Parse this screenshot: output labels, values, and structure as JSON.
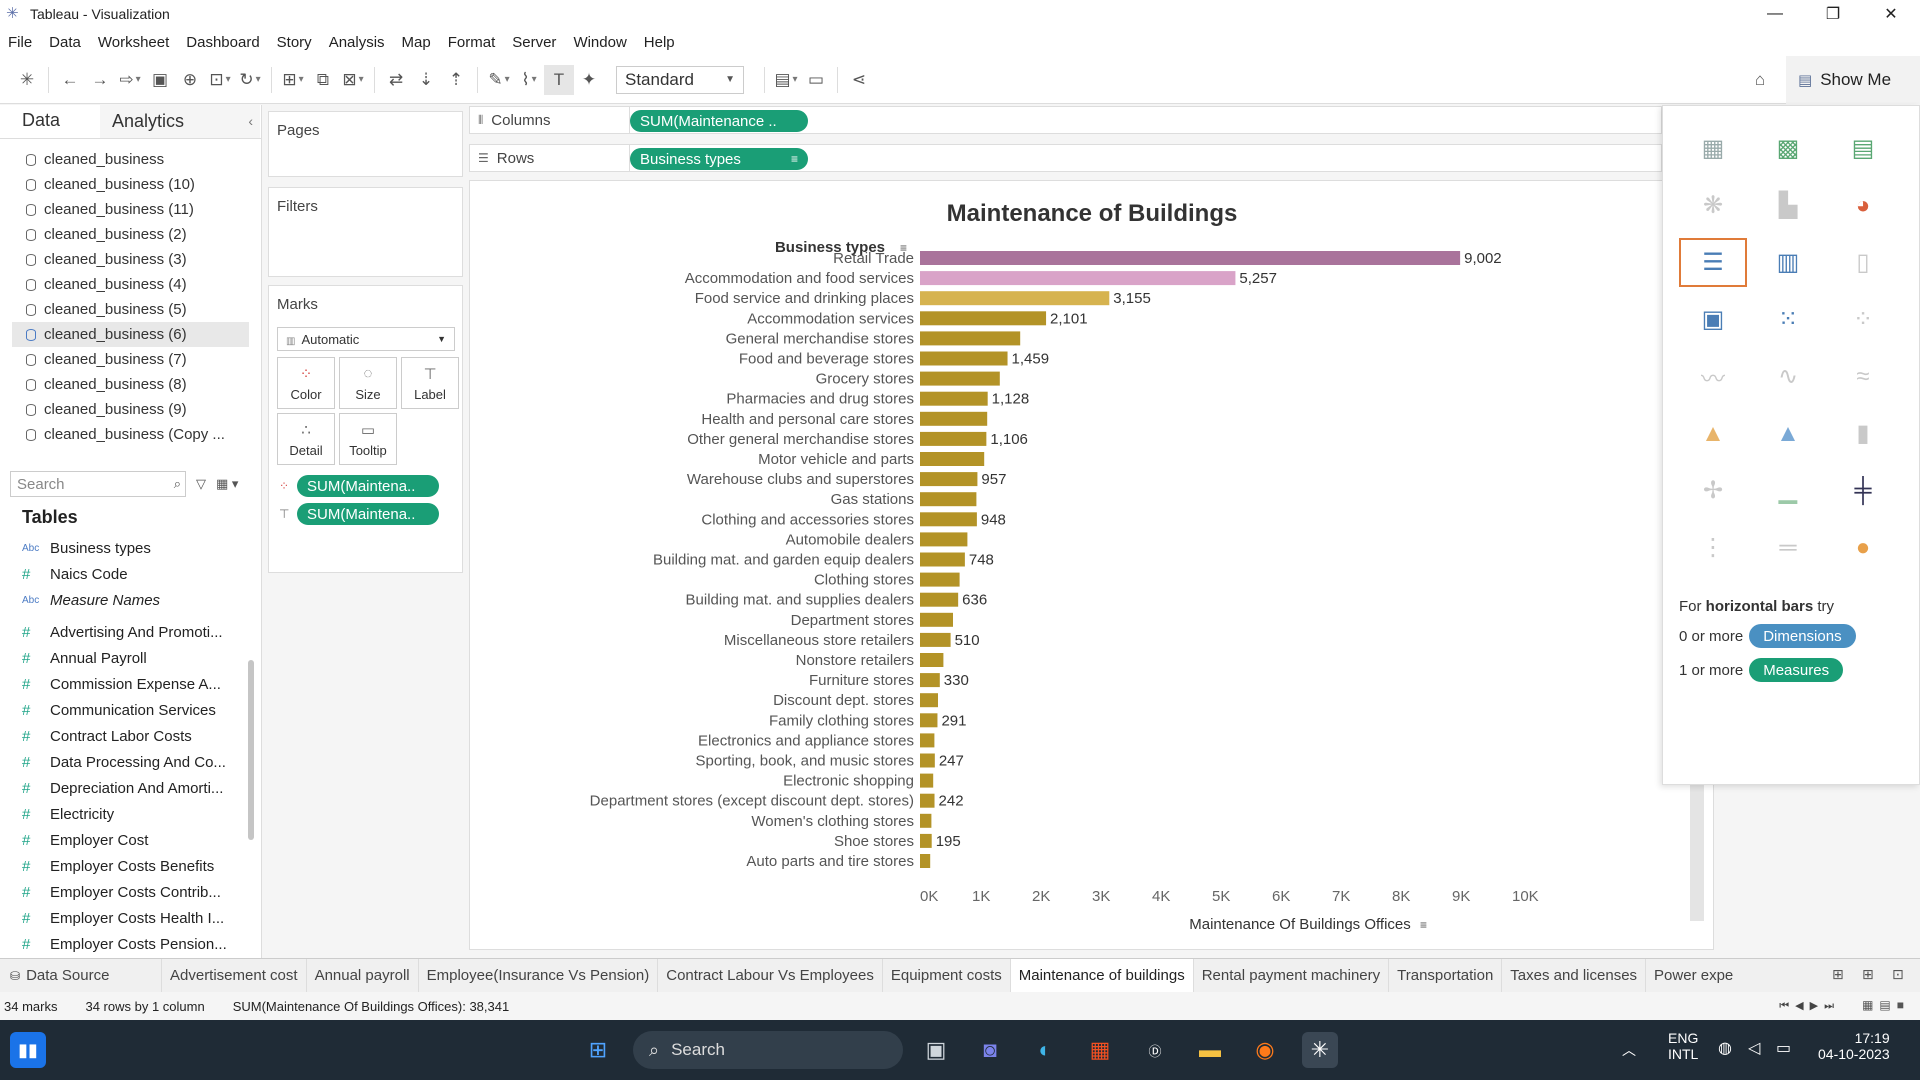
{
  "window": {
    "title": "Tableau - Visualization"
  },
  "menu": [
    "File",
    "Data",
    "Worksheet",
    "Dashboard",
    "Story",
    "Analysis",
    "Map",
    "Format",
    "Server",
    "Window",
    "Help"
  ],
  "toolbar": {
    "fit": "Standard",
    "show_me": "Show Me"
  },
  "data_pane": {
    "tab_data": "Data",
    "tab_analytics": "Analytics",
    "datasources": [
      "cleaned_business",
      "cleaned_business (10)",
      "cleaned_business (11)",
      "cleaned_business (2)",
      "cleaned_business (3)",
      "cleaned_business (4)",
      "cleaned_business (5)",
      "cleaned_business (6)",
      "cleaned_business (7)",
      "cleaned_business (8)",
      "cleaned_business (9)",
      "cleaned_business (Copy ..."
    ],
    "selected_index": 7,
    "search_placeholder": "Search",
    "tables_heading": "Tables",
    "dimensions": [
      {
        "type": "Abc",
        "name": "Business types"
      },
      {
        "type": "#",
        "name": "Naics Code"
      },
      {
        "type": "Abc",
        "name": "Measure Names"
      }
    ],
    "measures": [
      "Advertising And Promoti...",
      "Annual Payroll",
      "Commission Expense A...",
      "Communication Services",
      "Contract Labor Costs",
      "Data Processing And Co...",
      "Depreciation And Amorti...",
      "Electricity",
      "Employer Cost",
      "Employer Costs Benefits",
      "Employer Costs Contrib...",
      "Employer Costs Health I...",
      "Employer Costs Pension..."
    ]
  },
  "cards": {
    "pages": "Pages",
    "filters": "Filters",
    "marks": "Marks",
    "mark_type": "Automatic",
    "buttons": [
      "Color",
      "Size",
      "Label",
      "Detail",
      "Tooltip"
    ],
    "pills": [
      "SUM(Maintena..",
      "SUM(Maintena.."
    ]
  },
  "shelves": {
    "columns_label": "Columns",
    "columns_pill": "SUM(Maintenance ..",
    "rows_label": "Rows",
    "rows_pill": "Business types"
  },
  "chart_data": {
    "type": "bar",
    "orientation": "horizontal",
    "title": "Maintenance of Buildings",
    "category_header": "Business types",
    "xlabel": "Maintenance Of Buildings Offices",
    "xlim": [
      0,
      10000
    ],
    "xticks": [
      "0K",
      "1K",
      "2K",
      "3K",
      "4K",
      "5K",
      "6K",
      "7K",
      "8K",
      "9K",
      "10K"
    ],
    "grid": false,
    "colors": {
      "top": "#a9739b",
      "second": "#d9a3c8",
      "third": "#d6b34f",
      "rest": "#b39327"
    },
    "categories": [
      "Retail Trade",
      "Accommodation and food services",
      "Food service and drinking places",
      "Accommodation services",
      "General merchandise stores",
      "Food and beverage stores",
      "Grocery stores",
      "Pharmacies and drug stores",
      "Health and personal care stores",
      "Other general merchandise stores",
      "Motor vehicle and parts",
      "Warehouse clubs and superstores",
      "Gas stations",
      "Clothing and accessories stores",
      "Automobile dealers",
      "Building mat. and garden equip dealers",
      "Clothing stores",
      "Building mat. and supplies dealers",
      "Department stores",
      "Miscellaneous store retailers",
      "Nonstore retailers",
      "Furniture stores",
      "Discount dept. stores",
      "Family clothing stores",
      "Electronics and appliance stores",
      "Sporting, book, and  music stores",
      "Electronic shopping",
      "Department stores (except discount dept. stores)",
      "Women's clothing stores",
      "Shoe stores",
      "Auto parts and tire stores"
    ],
    "values": [
      9002,
      5257,
      3155,
      2101,
      1670,
      1459,
      1330,
      1128,
      1120,
      1106,
      1070,
      957,
      940,
      948,
      790,
      748,
      660,
      636,
      550,
      510,
      390,
      330,
      300,
      291,
      240,
      247,
      220,
      242,
      190,
      195,
      170
    ],
    "labels": [
      "9,002",
      "5,257",
      "3,155",
      "2,101",
      "",
      "1,459",
      "",
      "1,128",
      "",
      "1,106",
      "",
      "957",
      "",
      "948",
      "",
      "748",
      "",
      "636",
      "",
      "510",
      "",
      "330",
      "",
      "291",
      "",
      "247",
      "",
      "242",
      "",
      "195",
      ""
    ]
  },
  "show_me": {
    "hint_prefix": "For ",
    "hint_bold": "horizontal bars",
    "hint_suffix": " try",
    "dim_prefix": "0 or more",
    "dim_badge": "Dimensions",
    "meas_prefix": "1 or more",
    "meas_badge": "Measures",
    "colors": {
      "dimensions": "#4a90c2",
      "measures": "#1a9e76"
    }
  },
  "sheet_tabs": [
    "Data Source",
    "Advertisement cost",
    "Annual payroll",
    "Employee(Insurance  Vs Pension)",
    "Contract Labour Vs Employees",
    "Equipment costs",
    "Maintenance of buildings",
    "Rental payment machinery",
    "Transportation",
    "Taxes and licenses",
    "Power expe"
  ],
  "active_sheet": 6,
  "status": {
    "marks": "34 marks",
    "rows": "34 rows by 1 column",
    "sum": "SUM(Maintenance Of Buildings Offices): 38,341"
  },
  "taskbar": {
    "search": "Search",
    "lang1": "ENG",
    "lang2": "INTL",
    "time": "17:19",
    "date": "04-10-2023"
  }
}
